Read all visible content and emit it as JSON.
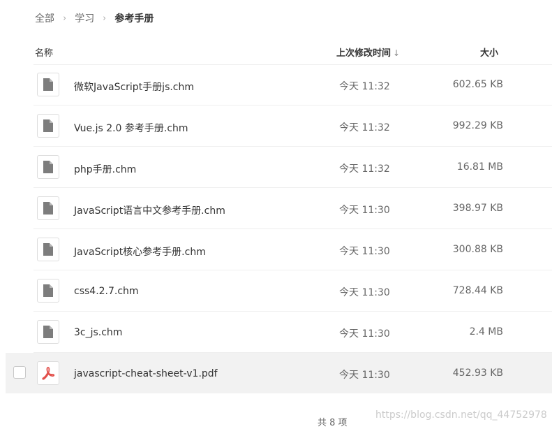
{
  "breadcrumb": {
    "items": [
      {
        "label": "全部"
      },
      {
        "label": "学习"
      },
      {
        "label": "参考手册"
      }
    ],
    "separator": "›"
  },
  "table": {
    "headers": {
      "name": "名称",
      "modified": "上次修改时间",
      "size": "大小"
    },
    "sort_indicator": "↓",
    "rows": [
      {
        "name": "微软JavaScript手册js.chm",
        "modified": "今天 11:32",
        "size": "602.65 KB",
        "icon": "doc-icon"
      },
      {
        "name": "Vue.js 2.0 参考手册.chm",
        "modified": "今天 11:32",
        "size": "992.29 KB",
        "icon": "doc-icon"
      },
      {
        "name": "php手册.chm",
        "modified": "今天 11:32",
        "size": "16.81 MB",
        "icon": "doc-icon"
      },
      {
        "name": "JavaScript语言中文参考手册.chm",
        "modified": "今天 11:30",
        "size": "398.97 KB",
        "icon": "doc-icon"
      },
      {
        "name": "JavaScript核心参考手册.chm",
        "modified": "今天 11:30",
        "size": "300.88 KB",
        "icon": "doc-icon"
      },
      {
        "name": "css4.2.7.chm",
        "modified": "今天 11:30",
        "size": "728.44 KB",
        "icon": "doc-icon"
      },
      {
        "name": "3c_js.chm",
        "modified": "今天 11:30",
        "size": "2.4 MB",
        "icon": "doc-icon"
      },
      {
        "name": "javascript-cheat-sheet-v1.pdf",
        "modified": "今天 11:30",
        "size": "452.93 KB",
        "icon": "pdf-icon"
      }
    ]
  },
  "footer": {
    "count_label": "共 8 项"
  },
  "watermark": "https://blog.csdn.net/qq_44752978",
  "colors": {
    "doc_icon": "#7d7d7d",
    "pdf_icon": "#e2504b",
    "hover_row": "#f2f2f2"
  }
}
